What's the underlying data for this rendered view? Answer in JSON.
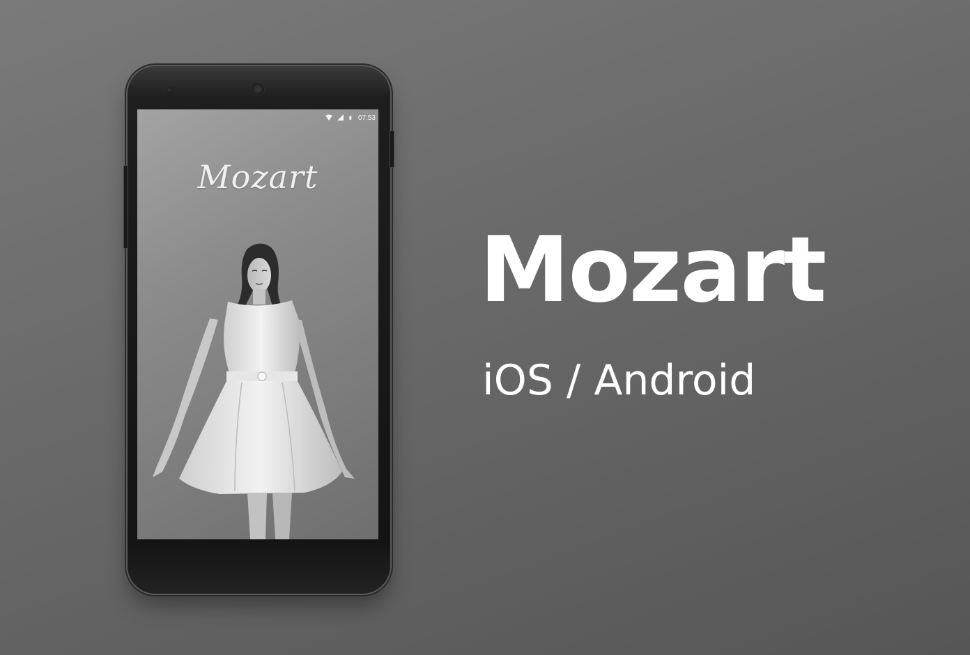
{
  "colors": {
    "background": "#6a6a6a",
    "phone_body": "#161616",
    "text": "#ffffff"
  },
  "phone": {
    "status_bar": {
      "time": "07:53",
      "icons": [
        "wifi-icon",
        "signal-icon",
        "battery-icon"
      ]
    },
    "app_logo": "Mozart",
    "screen_image": "model-in-white-dress"
  },
  "headline": {
    "title": "Mozart",
    "subtitle": "iOS / Android"
  }
}
